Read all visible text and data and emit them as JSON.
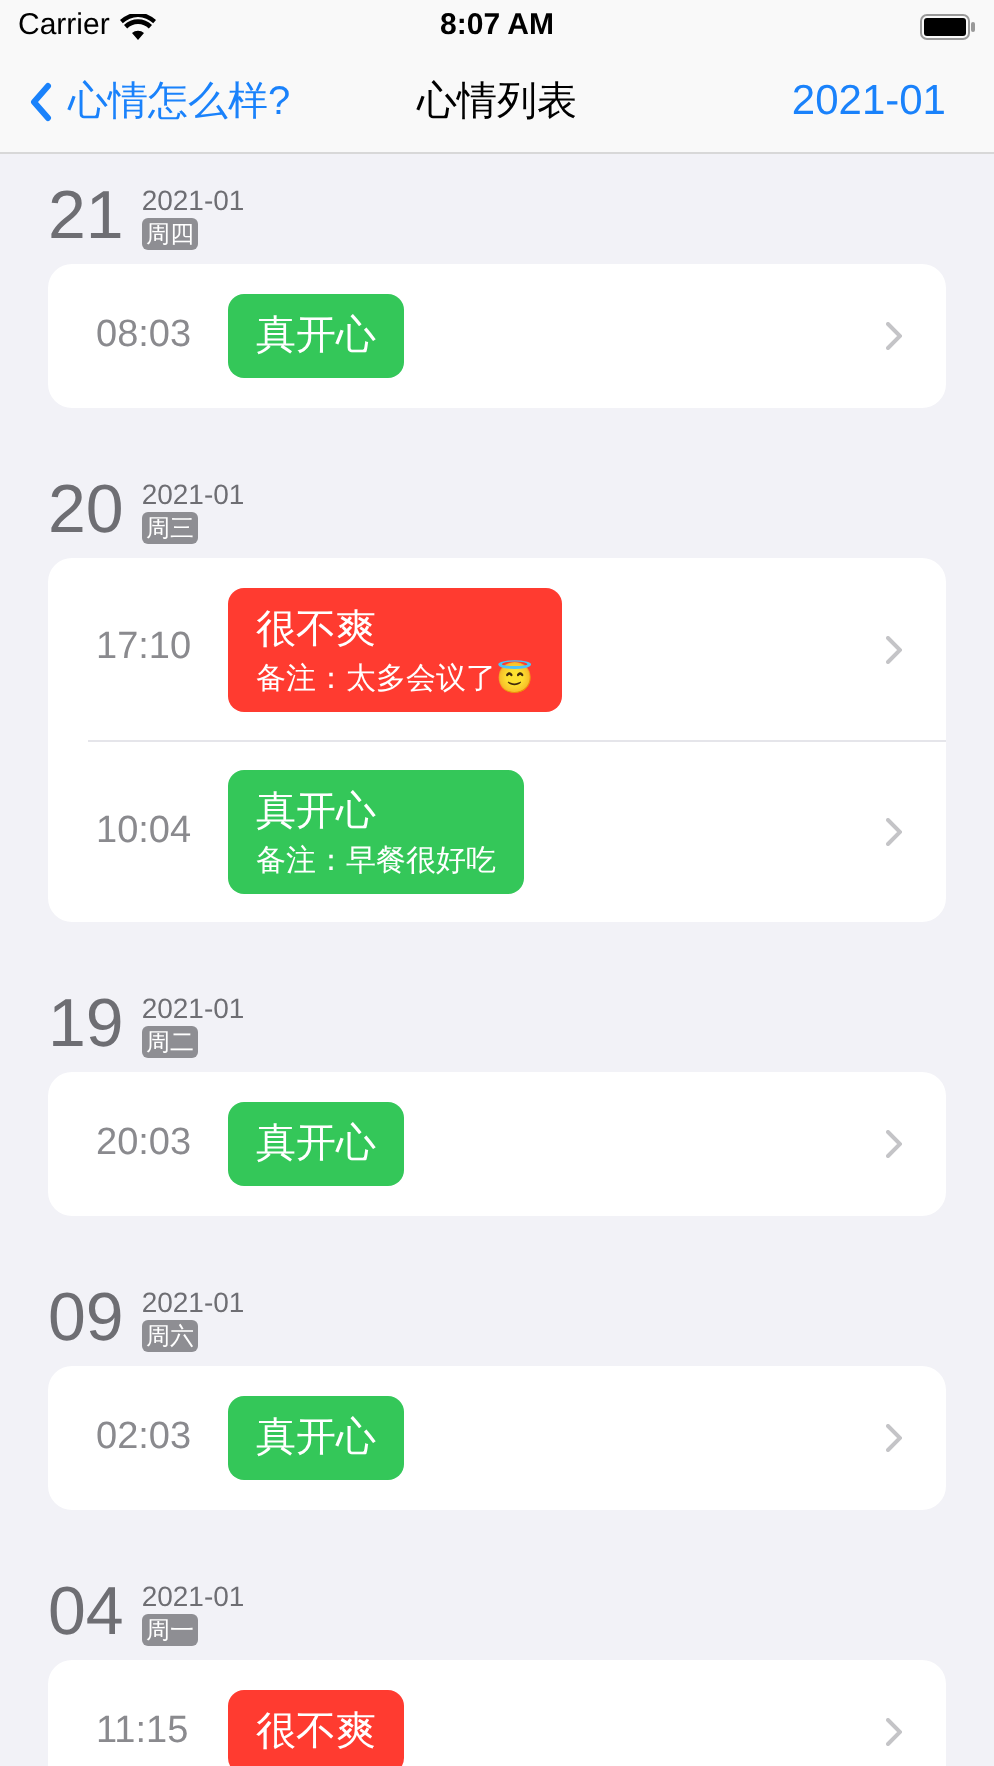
{
  "status_bar": {
    "carrier": "Carrier",
    "time": "8:07 AM"
  },
  "nav": {
    "back": "心情怎么样?",
    "title": "心情列表",
    "month": "2021-01"
  },
  "days": [
    {
      "day": "21",
      "month": "2021-01",
      "weekday": "周四",
      "entries": [
        {
          "time": "08:03",
          "mood": "真开心",
          "color": "#34c759"
        }
      ]
    },
    {
      "day": "20",
      "month": "2021-01",
      "weekday": "周三",
      "entries": [
        {
          "time": "17:10",
          "mood": "很不爽",
          "color": "#ff3b30",
          "note": "备注：太多会议了😇"
        },
        {
          "time": "10:04",
          "mood": "真开心",
          "color": "#34c759",
          "note": "备注：早餐很好吃"
        }
      ]
    },
    {
      "day": "19",
      "month": "2021-01",
      "weekday": "周二",
      "entries": [
        {
          "time": "20:03",
          "mood": "真开心",
          "color": "#34c759"
        }
      ]
    },
    {
      "day": "09",
      "month": "2021-01",
      "weekday": "周六",
      "entries": [
        {
          "time": "02:03",
          "mood": "真开心",
          "color": "#34c759"
        }
      ]
    },
    {
      "day": "04",
      "month": "2021-01",
      "weekday": "周一",
      "entries": [
        {
          "time": "11:15",
          "mood": "很不爽",
          "color": "#ff3b30"
        }
      ]
    }
  ]
}
